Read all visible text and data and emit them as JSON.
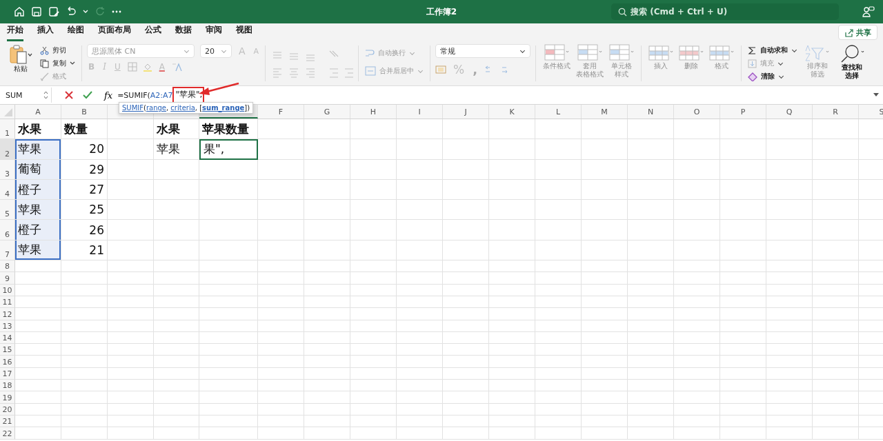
{
  "title_bar": {
    "title": "工作簿2",
    "search_placeholder": "搜索 (Cmd + Ctrl + U)",
    "redo_disabled": true
  },
  "menu_tabs": [
    {
      "label": "开始",
      "selected": true
    },
    {
      "label": "插入",
      "selected": false
    },
    {
      "label": "绘图",
      "selected": false
    },
    {
      "label": "页面布局",
      "selected": false
    },
    {
      "label": "公式",
      "selected": false
    },
    {
      "label": "数据",
      "selected": false
    },
    {
      "label": "审阅",
      "selected": false
    },
    {
      "label": "视图",
      "selected": false
    }
  ],
  "share_button": "共享",
  "ribbon": {
    "paste": {
      "label": "粘贴",
      "disabled": false
    },
    "clipboard": [
      {
        "kind": "cut",
        "label": "剪切",
        "disabled": false
      },
      {
        "kind": "copy",
        "label": "复制",
        "disabled": false
      },
      {
        "kind": "painter",
        "label": "格式",
        "disabled": true
      }
    ],
    "font_name": "思源黑体 CN",
    "font_size": "20",
    "font_letters": {
      "grow": "A",
      "shrink": "A",
      "bold": "B",
      "italic": "I",
      "underline": "U",
      "font_color": "A"
    },
    "wrap_text": "自动换行",
    "merge": "合并后居中",
    "number_format": "常规",
    "percent": "%",
    "comma": ",",
    "styles": [
      {
        "kind": "conditional",
        "lines": [
          "条件格式"
        ],
        "disabled": true
      },
      {
        "kind": "table",
        "lines": [
          "套用",
          "表格格式"
        ],
        "disabled": true
      },
      {
        "kind": "cell_style",
        "lines": [
          "单元格",
          "样式"
        ],
        "disabled": true
      }
    ],
    "cells": [
      {
        "kind": "insert",
        "lines": [
          "插入"
        ],
        "disabled": true
      },
      {
        "kind": "delete",
        "lines": [
          "删除"
        ],
        "disabled": true
      },
      {
        "kind": "format",
        "lines": [
          "格式"
        ],
        "disabled": true
      }
    ],
    "editing": [
      {
        "kind": "autosum",
        "label": "自动求和",
        "disabled": false
      },
      {
        "kind": "fill",
        "label": "填充",
        "disabled": true
      },
      {
        "kind": "clear",
        "label": "清除",
        "disabled": false
      }
    ],
    "sort": {
      "lines": [
        "排序和",
        "筛选"
      ],
      "disabled": true
    },
    "find": {
      "lines": [
        "查找和",
        "选择"
      ],
      "disabled": false
    }
  },
  "formula_bar": {
    "name_box": "SUM",
    "fx": "fx",
    "formula": [
      {
        "kind": "text",
        "text": "=SUMIF(",
        "highlighted": false
      },
      {
        "kind": "ref",
        "text": "A2:A7",
        "highlighted": false
      },
      {
        "kind": "text",
        "text": "\"苹果\",",
        "highlighted": true
      }
    ],
    "tooltip": [
      {
        "kind": "link",
        "text": "SUMIF"
      },
      {
        "kind": "plain",
        "text": "("
      },
      {
        "kind": "link",
        "text": "range"
      },
      {
        "kind": "plain",
        "text": ", "
      },
      {
        "kind": "link",
        "text": "criteria"
      },
      {
        "kind": "plain",
        "text": ", ["
      },
      {
        "kind": "current",
        "text": "sum_range"
      },
      {
        "kind": "plain",
        "text": "])"
      }
    ]
  },
  "columns": [
    {
      "label": "A",
      "selected": false
    },
    {
      "label": "B",
      "selected": false
    },
    {
      "selected": false
    },
    {
      "selected": false
    },
    {
      "selected": true
    },
    {
      "label": "F",
      "selected": false
    },
    {
      "label": "G",
      "selected": false
    },
    {
      "label": "H",
      "selected": false
    },
    {
      "label": "I",
      "selected": false
    },
    {
      "label": "J",
      "selected": false
    },
    {
      "label": "K",
      "selected": false
    },
    {
      "label": "L",
      "selected": false
    },
    {
      "label": "M",
      "selected": false
    },
    {
      "label": "N",
      "selected": false
    },
    {
      "label": "O",
      "selected": false
    },
    {
      "label": "P",
      "selected": false
    },
    {
      "label": "Q",
      "selected": false
    },
    {
      "label": "R",
      "selected": false
    },
    {
      "label": "S",
      "selected": false
    }
  ],
  "rows": [
    {
      "label": "1",
      "selected": false,
      "cells": [
        {
          "kind": "text",
          "value": "水果",
          "bold": true,
          "in_range": false,
          "active": false
        },
        {
          "kind": "text",
          "value": "数量",
          "bold": true,
          "in_range": false,
          "active": false
        },
        null,
        {
          "kind": "text",
          "value": "水果",
          "bold": true,
          "in_range": false,
          "active": false
        },
        {
          "kind": "text",
          "value": "苹果数量",
          "bold": true,
          "in_range": false,
          "active": false
        }
      ]
    },
    {
      "label": "2",
      "selected": true,
      "cells": [
        {
          "kind": "text",
          "value": "苹果",
          "bold": false,
          "in_range": true,
          "active": false
        },
        {
          "kind": "number",
          "value": "20",
          "bold": false,
          "in_range": false,
          "active": false
        },
        null,
        {
          "kind": "text",
          "value": "苹果",
          "bold": false,
          "in_range": false,
          "active": false
        },
        {
          "kind": "text",
          "value": "果\",",
          "bold": false,
          "in_range": false,
          "active": true
        }
      ]
    },
    {
      "label": "3",
      "selected": false,
      "cells": [
        {
          "kind": "text",
          "value": "葡萄",
          "bold": false,
          "in_range": true,
          "active": false
        },
        {
          "kind": "number",
          "value": "29",
          "bold": false,
          "in_range": false,
          "active": false
        }
      ]
    },
    {
      "label": "4",
      "selected": false,
      "cells": [
        {
          "kind": "text",
          "value": "橙子",
          "bold": false,
          "in_range": true,
          "active": false
        },
        {
          "kind": "number",
          "value": "27",
          "bold": false,
          "in_range": false,
          "active": false
        }
      ]
    },
    {
      "label": "5",
      "selected": false,
      "cells": [
        {
          "kind": "text",
          "value": "苹果",
          "bold": false,
          "in_range": true,
          "active": false
        },
        {
          "kind": "number",
          "value": "25",
          "bold": false,
          "in_range": false,
          "active": false
        }
      ]
    },
    {
      "label": "6",
      "selected": false,
      "cells": [
        {
          "kind": "text",
          "value": "橙子",
          "bold": false,
          "in_range": true,
          "active": false
        },
        {
          "kind": "number",
          "value": "26",
          "bold": false,
          "in_range": false,
          "active": false
        }
      ]
    },
    {
      "label": "7",
      "selected": false,
      "cells": [
        {
          "kind": "text",
          "value": "苹果",
          "bold": false,
          "in_range": true,
          "active": false
        },
        {
          "kind": "number",
          "value": "21",
          "bold": false,
          "in_range": false,
          "active": false
        }
      ]
    },
    {
      "label": "8",
      "selected": false
    },
    {
      "label": "9",
      "selected": false
    },
    {
      "label": "10",
      "selected": false
    },
    {
      "label": "11",
      "selected": false
    },
    {
      "label": "12",
      "selected": false
    },
    {
      "label": "13",
      "selected": false
    },
    {
      "label": "14",
      "selected": false
    },
    {
      "label": "15",
      "selected": false
    },
    {
      "label": "16",
      "selected": false
    },
    {
      "label": "17",
      "selected": false
    },
    {
      "label": "18",
      "selected": false
    },
    {
      "label": "19",
      "selected": false
    },
    {
      "label": "20",
      "selected": false
    },
    {
      "label": "21",
      "selected": false
    },
    {
      "label": "22",
      "selected": false
    }
  ]
}
